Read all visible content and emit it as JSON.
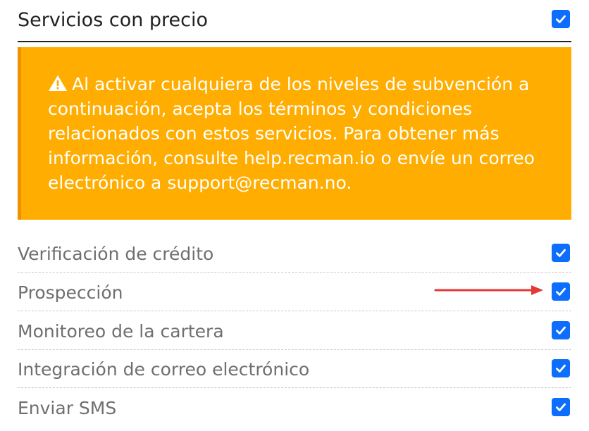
{
  "header": {
    "title": "Servicios con precio",
    "checked": true
  },
  "alert": {
    "icon": "warning-icon",
    "message": "Al activar cualquiera de los niveles de subvención a continuación, acepta los términos y condiciones relacionados con estos servicios. Para obtener más información, consulte help.recman.io o envíe un correo electrónico a support@recman.no."
  },
  "services": [
    {
      "label": "Verificación de crédito",
      "checked": true
    },
    {
      "label": "Prospección",
      "checked": true
    },
    {
      "label": "Monitoreo de la cartera",
      "checked": true
    },
    {
      "label": "Integración de correo electrónico",
      "checked": true
    },
    {
      "label": "Enviar SMS",
      "checked": true
    }
  ],
  "colors": {
    "accent": "#0d6efd",
    "alert_bg": "#ffad00",
    "alert_border": "#f09200",
    "arrow": "#e53935"
  }
}
